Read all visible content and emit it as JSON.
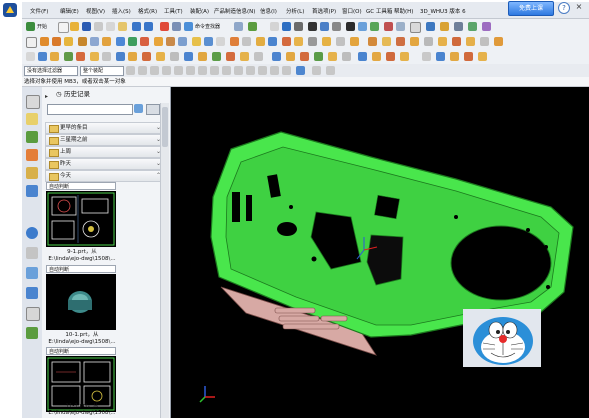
{
  "menubar": {
    "items": [
      "文件(F)",
      "编辑(E)",
      "视图(V)",
      "插入(S)",
      "格式(R)",
      "工具(T)",
      "装配(A)",
      "产品制造信息(N)",
      "信息(I)",
      "分析(L)",
      "首选项(P)",
      "窗口(O)",
      "GC 工具箱",
      "帮助(H)",
      "3D_WHU3 版本 6"
    ],
    "upgrade_button": "免费上课",
    "help_icon": "?",
    "close_icon": "×"
  },
  "toolbar": {
    "start_label": "开始",
    "command_finder_label": "命令查找器"
  },
  "selection_bar": {
    "filter_value": "没有选择过滤器",
    "scope_value": "整个装配"
  },
  "status_bar": {
    "prompt": "选择对象并使用 MB3，或者双击某一对象"
  },
  "history_panel": {
    "title": "历史记录",
    "groups": [
      {
        "label": "更早的条目"
      },
      {
        "label": "三星期之前"
      },
      {
        "label": "上周"
      },
      {
        "label": "昨天"
      },
      {
        "label": "今天"
      }
    ],
    "items": [
      {
        "header": "自动判断",
        "name": "9-1.prt，从",
        "path": "E:\\linda\\ejo-dwg\\1508\\..."
      },
      {
        "header": "自动判断",
        "name": "10-1.prt，从",
        "path": "E:\\linda\\ejo-dwg\\1508\\..."
      },
      {
        "header": "自动判断",
        "name": "11-1.prt，从",
        "path": "E:\\linda\\ejo-dwg\\1508\\..."
      }
    ]
  },
  "colors": {
    "model_green": "#49e64c",
    "model_outline": "#1c7a1e",
    "boss_pink": "#d7a9a4",
    "viewport_bg": "#000000",
    "accent_blue": "#2e79e0"
  }
}
